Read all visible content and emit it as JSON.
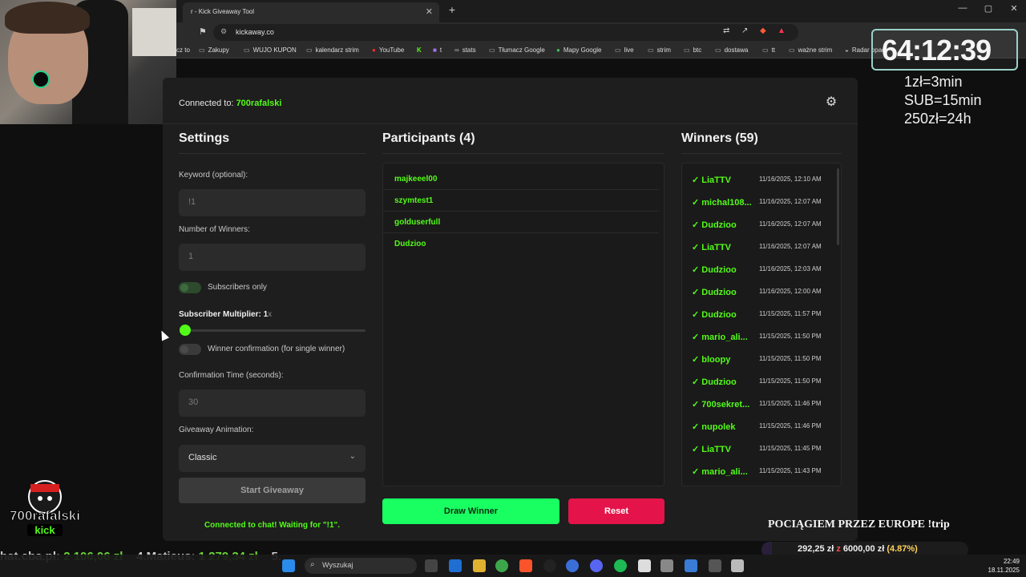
{
  "browser": {
    "tab_title": "r - Kick Giveaway Tool",
    "url": "kickaway.co",
    "bookmarks": [
      "cz to",
      "Zakupy",
      "WUJO KUPON",
      "kalendarz strim",
      "YouTube",
      "t",
      "stats",
      "Tłumacz Google",
      "Mapy Google",
      "live",
      "strim",
      "btc",
      "dostawa",
      "tt",
      "ważne strim",
      "Radar opad"
    ],
    "window_controls": [
      "—",
      "▢",
      "✕"
    ]
  },
  "overlay": {
    "timer": "64:12:39",
    "rates": [
      "1zł=3min",
      "SUB=15min",
      "250zł=24h"
    ],
    "ticker": {
      "left_prefix": "hat.cba.pl:",
      "left_amount": "2 106,06 zł",
      "rank": "4.Matieus:",
      "rank_amount": "1 279,34 zł",
      "tail": "5."
    },
    "logo_text": "700rafalski",
    "logo_sub": "kick",
    "trip_title": "POCIĄGIEM PRZEZ EUROPE !trip",
    "trip_current": "292,25 zł",
    "trip_sep": "z",
    "trip_goal": "6000,00 zł",
    "trip_pct": "(4.87%)",
    "trip_progress": 0.0487
  },
  "app": {
    "connected_label": "Connected to:",
    "channel": "700rafalski",
    "settings": {
      "title": "Settings",
      "keyword_label": "Keyword (optional):",
      "keyword_placeholder": "!1",
      "winners_label": "Number of Winners:",
      "winners_value": "1",
      "subs_only_label": "Subscribers only",
      "multiplier_label": "Subscriber Multiplier: 1",
      "multiplier_unit": "x",
      "multiplier_value": 1,
      "confirmation_label": "Winner confirmation (for single winner)",
      "conf_time_label": "Confirmation Time (seconds):",
      "conf_time_value": "30",
      "animation_label": "Giveaway Animation:",
      "animation_value": "Classic",
      "start_button": "Start Giveaway",
      "status": "Connected to chat! Waiting for \"!1\"."
    },
    "participants": {
      "title": "Participants (4)",
      "items": [
        "majkeeel00",
        "szymtest1",
        "golduserfull",
        "Dudzioo"
      ]
    },
    "actions": {
      "draw": "Draw Winner",
      "reset": "Reset"
    },
    "winners": {
      "title": "Winners (59)",
      "items": [
        {
          "name": "LiaTTV",
          "time": "11/16/2025, 12:10 AM"
        },
        {
          "name": "michal108...",
          "time": "11/16/2025, 12:07 AM"
        },
        {
          "name": "Dudzioo",
          "time": "11/16/2025, 12:07 AM"
        },
        {
          "name": "LiaTTV",
          "time": "11/16/2025, 12:07 AM"
        },
        {
          "name": "Dudzioo",
          "time": "11/16/2025, 12:03 AM"
        },
        {
          "name": "Dudzioo",
          "time": "11/16/2025, 12:00 AM"
        },
        {
          "name": "Dudzioo",
          "time": "11/15/2025, 11:57 PM"
        },
        {
          "name": "mario_ali...",
          "time": "11/15/2025, 11:50 PM"
        },
        {
          "name": "bloopy",
          "time": "11/15/2025, 11:50 PM"
        },
        {
          "name": "Dudzioo",
          "time": "11/15/2025, 11:50 PM"
        },
        {
          "name": "700sekret...",
          "time": "11/15/2025, 11:46 PM"
        },
        {
          "name": "nupolek",
          "time": "11/15/2025, 11:46 PM"
        },
        {
          "name": "LiaTTV",
          "time": "11/15/2025, 11:45 PM"
        },
        {
          "name": "mario_ali...",
          "time": "11/15/2025, 11:43 PM"
        }
      ]
    }
  },
  "taskbar": {
    "search_placeholder": "Wyszukaj",
    "time": "22:49",
    "date": "18.11.2025"
  },
  "colors": {
    "kick_green": "#53fc18",
    "draw_green": "#19ff62",
    "reset_red": "#e4144a"
  }
}
